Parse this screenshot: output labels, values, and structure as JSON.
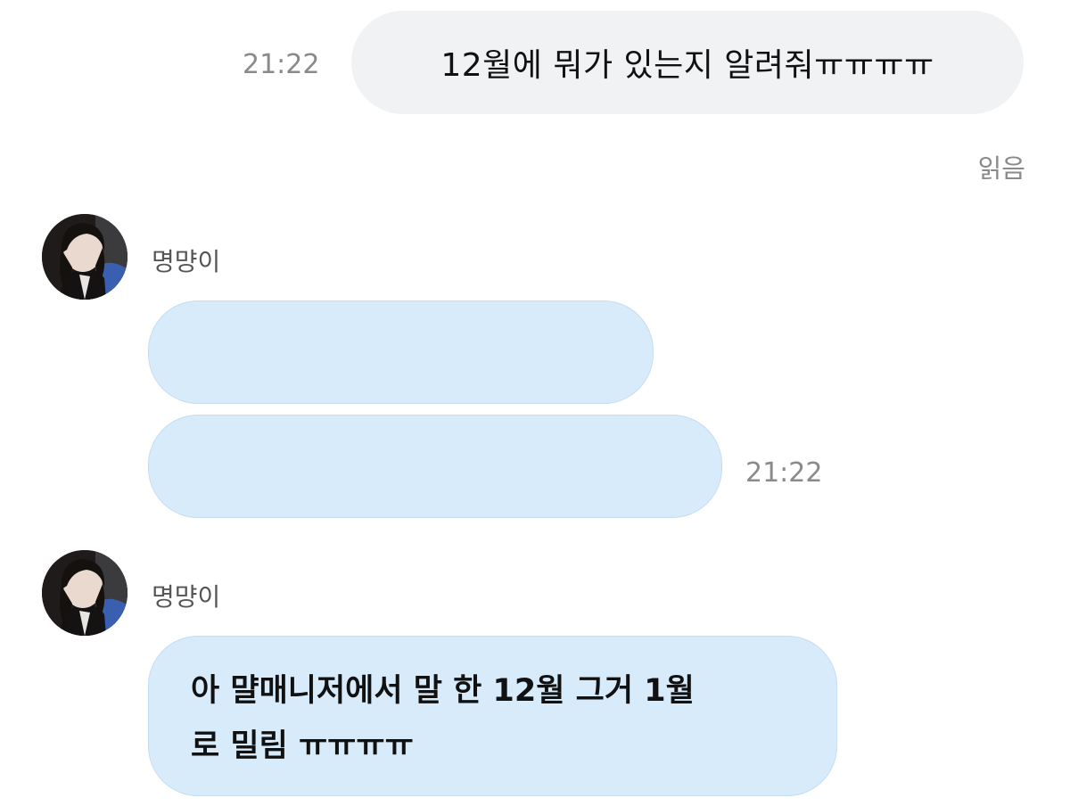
{
  "messages": {
    "outgoing": {
      "text": "12월에 뭐가 있는지 알려줘ㅠㅠㅠㅠ",
      "time": "21:22",
      "read_status": "읽음"
    },
    "incoming_group_1": {
      "sender": "명먕이",
      "bubbles": [
        "",
        ""
      ],
      "time": "21:22"
    },
    "incoming_group_2": {
      "sender": "명먕이",
      "line1": "아 먈매니저에서 말 한 12월 그거 1월",
      "line2": "로 밀림 ㅠㅠㅠㅠ"
    }
  },
  "colors": {
    "outgoing_bubble": "#f1f2f4",
    "incoming_bubble": "#d8ebfb",
    "timestamp": "#8a8a8a"
  },
  "icons": {
    "avatar": "profile-photo"
  }
}
